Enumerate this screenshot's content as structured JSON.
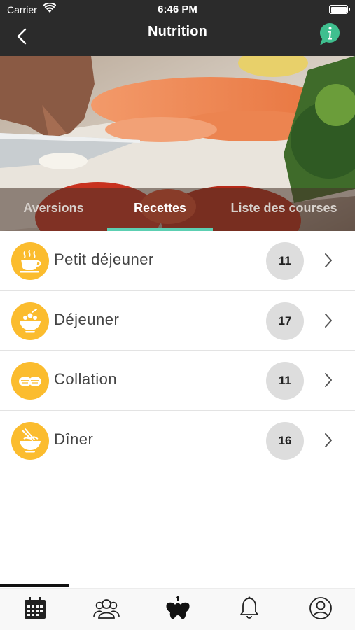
{
  "status_bar": {
    "carrier": "Carrier",
    "time": "6:46 PM"
  },
  "nav": {
    "title": "Nutrition",
    "back_icon": "chevron-left-icon",
    "info_icon": "info-bubble-icon"
  },
  "tabs": [
    {
      "label": "Aversions",
      "active": false
    },
    {
      "label": "Recettes",
      "active": true
    },
    {
      "label": "Liste des courses",
      "active": false
    }
  ],
  "meals": [
    {
      "label": "Petit déjeuner",
      "count": "11",
      "icon": "coffee-cup-icon"
    },
    {
      "label": "Déjeuner",
      "count": "17",
      "icon": "salad-bowl-icon"
    },
    {
      "label": "Collation",
      "count": "11",
      "icon": "snack-icon"
    },
    {
      "label": "Dîner",
      "count": "16",
      "icon": "noodle-bowl-icon"
    }
  ],
  "bottom_tabs": [
    {
      "icon": "calendar-icon"
    },
    {
      "icon": "community-icon"
    },
    {
      "icon": "body-icon"
    },
    {
      "icon": "bell-icon"
    },
    {
      "icon": "profile-icon"
    }
  ],
  "colors": {
    "accent": "#5ccfb2",
    "meal_icon_bg": "#fbbc2e",
    "badge_bg": "#dddddd",
    "top_bar": "#2b2b2b",
    "info_green": "#3fbf8f"
  }
}
